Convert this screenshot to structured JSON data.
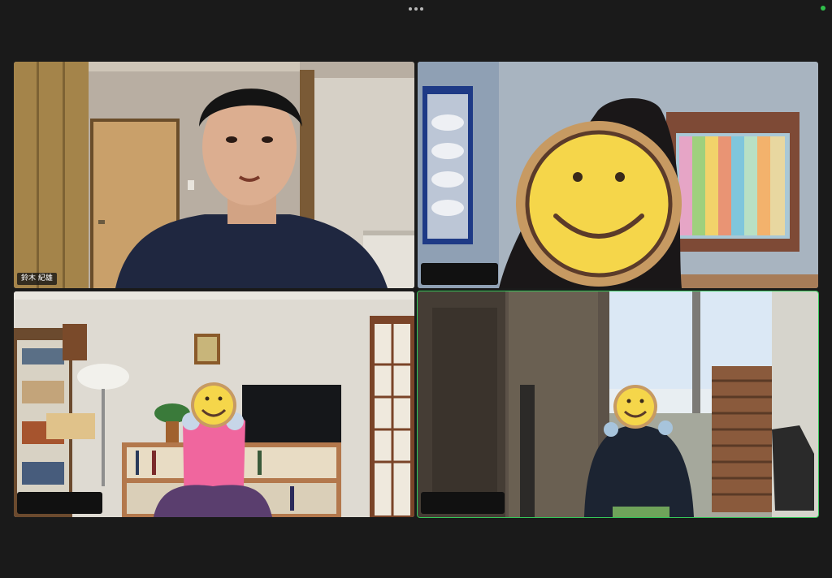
{
  "app": {
    "status_color": "#2fbf4a",
    "active_border_color": "#35c759",
    "more_menu_icon": "more-horizontal-icon"
  },
  "participants": [
    {
      "name": "鈴木 紀雄",
      "active_speaker": false,
      "video": "man-in-navy-tshirt-speaking"
    },
    {
      "name": "",
      "active_speaker": false,
      "video": "face-covered-by-smiley-sticker"
    },
    {
      "name": "",
      "active_speaker": false,
      "video": "woman-in-pink-exercising-squat"
    },
    {
      "name": "",
      "active_speaker": true,
      "video": "person-exercising-near-window"
    }
  ]
}
